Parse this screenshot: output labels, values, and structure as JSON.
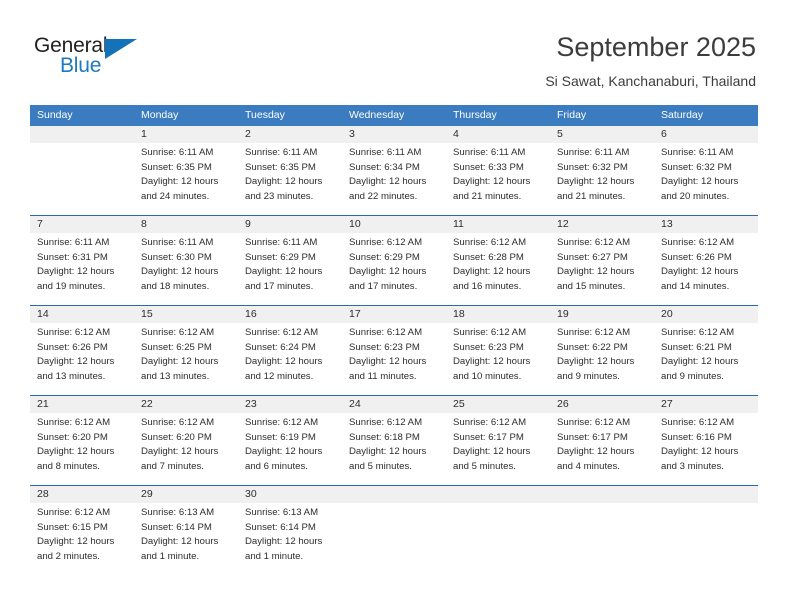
{
  "brand": {
    "name_top": "General",
    "name_bottom": "Blue",
    "triangle_color": "#1473b8",
    "text_color_top": "#231f20",
    "text_color_bottom": "#1f7ac0"
  },
  "header": {
    "title": "September 2025",
    "subtitle": "Si Sawat, Kanchanaburi, Thailand"
  },
  "theme": {
    "header_row_bg": "#3b7cc0",
    "date_strip_bg": "#f0f0f0",
    "week_divider": "#2a6aaf",
    "text": "#2d2d2d"
  },
  "calendar": {
    "weekdays": [
      "Sunday",
      "Monday",
      "Tuesday",
      "Wednesday",
      "Thursday",
      "Friday",
      "Saturday"
    ],
    "weeks": [
      {
        "dates": [
          "",
          "1",
          "2",
          "3",
          "4",
          "5",
          "6"
        ],
        "cells": [
          {
            "empty": true,
            "lines": [
              "",
              "",
              "",
              ""
            ]
          },
          {
            "empty": false,
            "lines": [
              "Sunrise: 6:11 AM",
              "Sunset: 6:35 PM",
              "Daylight: 12 hours",
              "and 24 minutes."
            ]
          },
          {
            "empty": false,
            "lines": [
              "Sunrise: 6:11 AM",
              "Sunset: 6:35 PM",
              "Daylight: 12 hours",
              "and 23 minutes."
            ]
          },
          {
            "empty": false,
            "lines": [
              "Sunrise: 6:11 AM",
              "Sunset: 6:34 PM",
              "Daylight: 12 hours",
              "and 22 minutes."
            ]
          },
          {
            "empty": false,
            "lines": [
              "Sunrise: 6:11 AM",
              "Sunset: 6:33 PM",
              "Daylight: 12 hours",
              "and 21 minutes."
            ]
          },
          {
            "empty": false,
            "lines": [
              "Sunrise: 6:11 AM",
              "Sunset: 6:32 PM",
              "Daylight: 12 hours",
              "and 21 minutes."
            ]
          },
          {
            "empty": false,
            "lines": [
              "Sunrise: 6:11 AM",
              "Sunset: 6:32 PM",
              "Daylight: 12 hours",
              "and 20 minutes."
            ]
          }
        ]
      },
      {
        "dates": [
          "7",
          "8",
          "9",
          "10",
          "11",
          "12",
          "13"
        ],
        "cells": [
          {
            "empty": false,
            "lines": [
              "Sunrise: 6:11 AM",
              "Sunset: 6:31 PM",
              "Daylight: 12 hours",
              "and 19 minutes."
            ]
          },
          {
            "empty": false,
            "lines": [
              "Sunrise: 6:11 AM",
              "Sunset: 6:30 PM",
              "Daylight: 12 hours",
              "and 18 minutes."
            ]
          },
          {
            "empty": false,
            "lines": [
              "Sunrise: 6:11 AM",
              "Sunset: 6:29 PM",
              "Daylight: 12 hours",
              "and 17 minutes."
            ]
          },
          {
            "empty": false,
            "lines": [
              "Sunrise: 6:12 AM",
              "Sunset: 6:29 PM",
              "Daylight: 12 hours",
              "and 17 minutes."
            ]
          },
          {
            "empty": false,
            "lines": [
              "Sunrise: 6:12 AM",
              "Sunset: 6:28 PM",
              "Daylight: 12 hours",
              "and 16 minutes."
            ]
          },
          {
            "empty": false,
            "lines": [
              "Sunrise: 6:12 AM",
              "Sunset: 6:27 PM",
              "Daylight: 12 hours",
              "and 15 minutes."
            ]
          },
          {
            "empty": false,
            "lines": [
              "Sunrise: 6:12 AM",
              "Sunset: 6:26 PM",
              "Daylight: 12 hours",
              "and 14 minutes."
            ]
          }
        ]
      },
      {
        "dates": [
          "14",
          "15",
          "16",
          "17",
          "18",
          "19",
          "20"
        ],
        "cells": [
          {
            "empty": false,
            "lines": [
              "Sunrise: 6:12 AM",
              "Sunset: 6:26 PM",
              "Daylight: 12 hours",
              "and 13 minutes."
            ]
          },
          {
            "empty": false,
            "lines": [
              "Sunrise: 6:12 AM",
              "Sunset: 6:25 PM",
              "Daylight: 12 hours",
              "and 13 minutes."
            ]
          },
          {
            "empty": false,
            "lines": [
              "Sunrise: 6:12 AM",
              "Sunset: 6:24 PM",
              "Daylight: 12 hours",
              "and 12 minutes."
            ]
          },
          {
            "empty": false,
            "lines": [
              "Sunrise: 6:12 AM",
              "Sunset: 6:23 PM",
              "Daylight: 12 hours",
              "and 11 minutes."
            ]
          },
          {
            "empty": false,
            "lines": [
              "Sunrise: 6:12 AM",
              "Sunset: 6:23 PM",
              "Daylight: 12 hours",
              "and 10 minutes."
            ]
          },
          {
            "empty": false,
            "lines": [
              "Sunrise: 6:12 AM",
              "Sunset: 6:22 PM",
              "Daylight: 12 hours",
              "and 9 minutes."
            ]
          },
          {
            "empty": false,
            "lines": [
              "Sunrise: 6:12 AM",
              "Sunset: 6:21 PM",
              "Daylight: 12 hours",
              "and 9 minutes."
            ]
          }
        ]
      },
      {
        "dates": [
          "21",
          "22",
          "23",
          "24",
          "25",
          "26",
          "27"
        ],
        "cells": [
          {
            "empty": false,
            "lines": [
              "Sunrise: 6:12 AM",
              "Sunset: 6:20 PM",
              "Daylight: 12 hours",
              "and 8 minutes."
            ]
          },
          {
            "empty": false,
            "lines": [
              "Sunrise: 6:12 AM",
              "Sunset: 6:20 PM",
              "Daylight: 12 hours",
              "and 7 minutes."
            ]
          },
          {
            "empty": false,
            "lines": [
              "Sunrise: 6:12 AM",
              "Sunset: 6:19 PM",
              "Daylight: 12 hours",
              "and 6 minutes."
            ]
          },
          {
            "empty": false,
            "lines": [
              "Sunrise: 6:12 AM",
              "Sunset: 6:18 PM",
              "Daylight: 12 hours",
              "and 5 minutes."
            ]
          },
          {
            "empty": false,
            "lines": [
              "Sunrise: 6:12 AM",
              "Sunset: 6:17 PM",
              "Daylight: 12 hours",
              "and 5 minutes."
            ]
          },
          {
            "empty": false,
            "lines": [
              "Sunrise: 6:12 AM",
              "Sunset: 6:17 PM",
              "Daylight: 12 hours",
              "and 4 minutes."
            ]
          },
          {
            "empty": false,
            "lines": [
              "Sunrise: 6:12 AM",
              "Sunset: 6:16 PM",
              "Daylight: 12 hours",
              "and 3 minutes."
            ]
          }
        ]
      },
      {
        "dates": [
          "28",
          "29",
          "30",
          "",
          "",
          "",
          ""
        ],
        "cells": [
          {
            "empty": false,
            "lines": [
              "Sunrise: 6:12 AM",
              "Sunset: 6:15 PM",
              "Daylight: 12 hours",
              "and 2 minutes."
            ]
          },
          {
            "empty": false,
            "lines": [
              "Sunrise: 6:13 AM",
              "Sunset: 6:14 PM",
              "Daylight: 12 hours",
              "and 1 minute."
            ]
          },
          {
            "empty": false,
            "lines": [
              "Sunrise: 6:13 AM",
              "Sunset: 6:14 PM",
              "Daylight: 12 hours",
              "and 1 minute."
            ]
          },
          {
            "empty": true,
            "lines": [
              "",
              "",
              "",
              ""
            ]
          },
          {
            "empty": true,
            "lines": [
              "",
              "",
              "",
              ""
            ]
          },
          {
            "empty": true,
            "lines": [
              "",
              "",
              "",
              ""
            ]
          },
          {
            "empty": true,
            "lines": [
              "",
              "",
              "",
              ""
            ]
          }
        ]
      }
    ]
  }
}
